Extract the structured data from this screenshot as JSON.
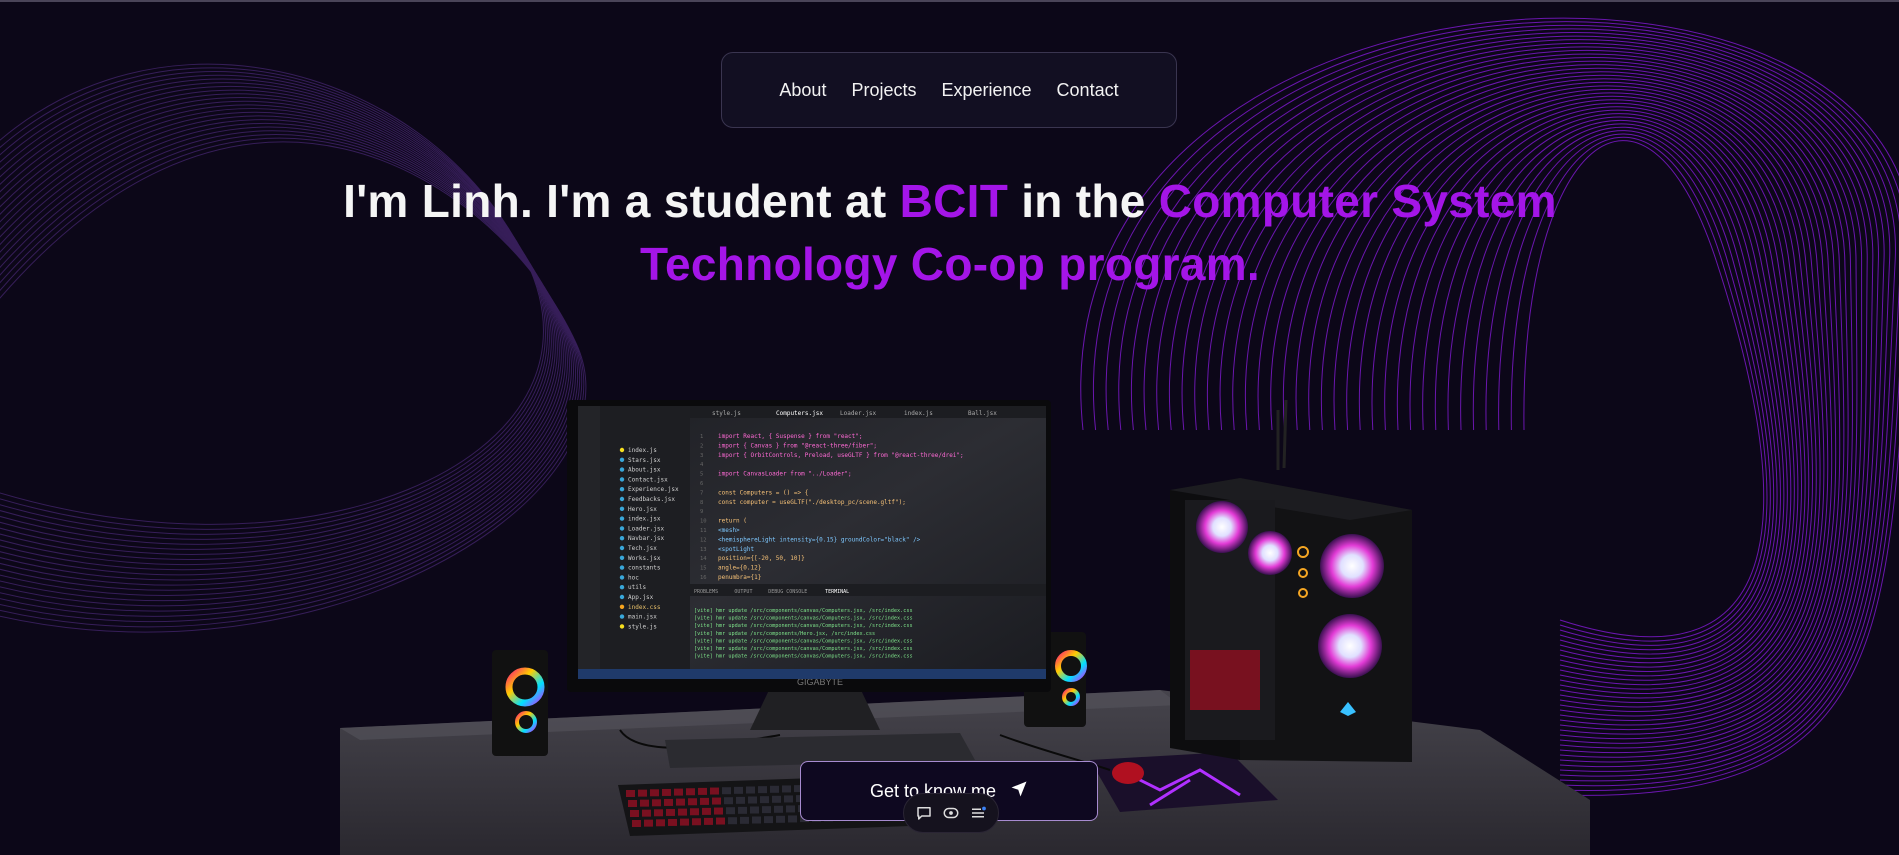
{
  "nav": {
    "items": [
      "About",
      "Projects",
      "Experience",
      "Contact"
    ]
  },
  "hero": {
    "part1": "I'm Linh. I'm a student at ",
    "highlight1": "BCIT",
    "part2": " in the ",
    "highlight2": "Computer System Technology Co-op program."
  },
  "cta": {
    "label": "Get to know me"
  },
  "scene": {
    "monitor_brand": "GIGABYTE",
    "editor_tabs": [
      "style.js",
      "Computers.jsx",
      "Loader.jsx",
      "index.js",
      "Ball.jsx"
    ],
    "explorer_files": [
      "index.js",
      "Stars.jsx",
      "About.jsx",
      "Contact.jsx",
      "Experience.jsx",
      "Feedbacks.jsx",
      "Hero.jsx",
      "index.jsx",
      "Loader.jsx",
      "Navbar.jsx",
      "Tech.jsx",
      "Works.jsx",
      "constants",
      "hoc",
      "utils",
      "App.jsx",
      "index.css",
      "main.jsx",
      "style.js"
    ],
    "code_lines": [
      "import React, { Suspense } from \"react\";",
      "import { Canvas } from \"@react-three/fiber\";",
      "import { OrbitControls, Preload, useGLTF } from \"@react-three/drei\";",
      "",
      "import CanvasLoader from \"../Loader\";",
      "",
      "const Computers = () => {",
      "  const computer = useGLTF(\"./desktop_pc/scene.gltf\");",
      "",
      "  return (",
      "    <mesh>",
      "      <hemisphereLight intensity={0.15} groundColor=\"black\" />",
      "      <spotLight",
      "        position={[-20, 50, 10]}",
      "        angle={0.12}",
      "        penumbra={1}"
    ],
    "panel_tabs": [
      "PROBLEMS",
      "OUTPUT",
      "DEBUG CONSOLE",
      "TERMINAL"
    ],
    "terminal_lines": [
      "[vite] hmr update /src/components/canvas/Computers.jsx, /src/index.css",
      "[vite] hmr update /src/components/canvas/Computers.jsx, /src/index.css",
      "[vite] hmr update /src/components/canvas/Computers.jsx, /src/index.css",
      "[vite] hmr update /src/components/Hero.jsx, /src/index.css",
      "[vite] hmr update /src/components/canvas/Computers.jsx, /src/index.css",
      "[vite] hmr update /src/components/canvas/Computers.jsx, /src/index.css",
      "[vite] hmr update /src/components/canvas/Computers.jsx, /src/index.css"
    ]
  },
  "colors": {
    "background": "#0c0718",
    "accent": "#a415e8",
    "wave": "#8a1be0"
  },
  "toolbar_icons": [
    "comment-icon",
    "eye-icon",
    "menu-icon"
  ],
  "cta_icon": "send-arrow-icon"
}
